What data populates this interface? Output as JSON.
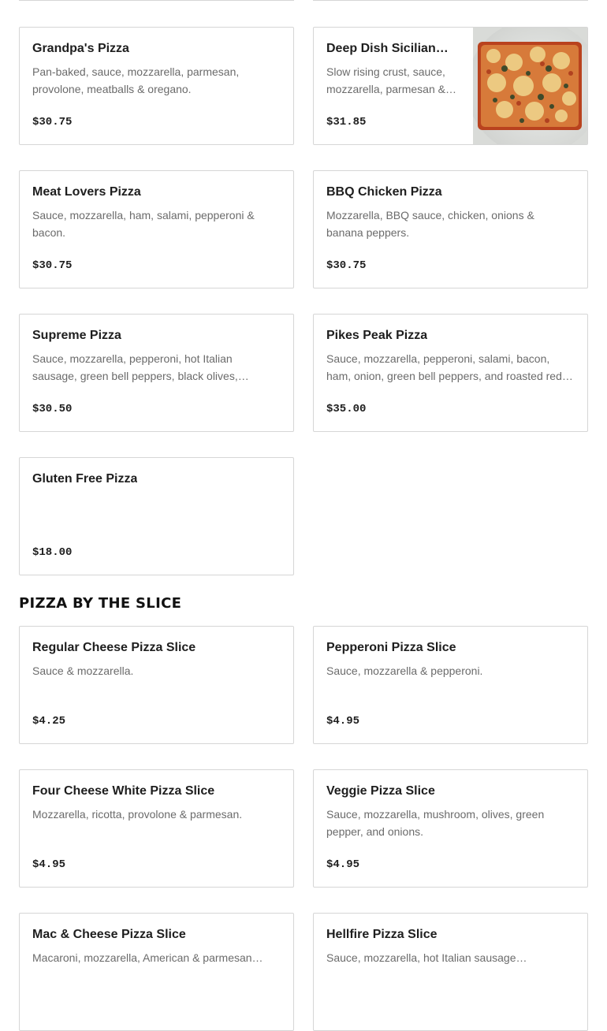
{
  "pizzas": [
    {
      "name": "Grandpa's Pizza",
      "desc": "Pan-baked, sauce, mozzarella, parmesan, provolone, meatballs & oregano.",
      "price": "$30.75"
    },
    {
      "name": "Deep Dish Sicilian…",
      "desc": "Slow rising crust, sauce, mozzarella, parmesan &…",
      "price": "$31.85",
      "image": "sicilian-pizza-photo"
    },
    {
      "name": "Meat Lovers Pizza",
      "desc": "Sauce, mozzarella, ham, salami, pepperoni & bacon.",
      "price": "$30.75"
    },
    {
      "name": "BBQ Chicken Pizza",
      "desc": "Mozzarella, BBQ sauce, chicken, onions & banana peppers.",
      "price": "$30.75"
    },
    {
      "name": "Supreme Pizza",
      "desc": "Sauce, mozzarella, pepperoni, hot Italian sausage, green bell peppers, black olives,…",
      "price": "$30.50"
    },
    {
      "name": "Pikes Peak Pizza",
      "desc": "Sauce, mozzarella, pepperoni, salami, bacon, ham, onion, green bell peppers, and roasted red…",
      "price": "$35.00"
    },
    {
      "name": "Gluten Free Pizza",
      "desc": "",
      "price": "$18.00"
    }
  ],
  "slice_section": {
    "title": "PIZZA BY THE SLICE"
  },
  "slices": [
    {
      "name": "Regular Cheese Pizza Slice",
      "desc": "Sauce & mozzarella.",
      "price": "$4.25"
    },
    {
      "name": "Pepperoni Pizza Slice",
      "desc": "Sauce, mozzarella & pepperoni.",
      "price": "$4.95"
    },
    {
      "name": "Four Cheese White Pizza Slice",
      "desc": "Mozzarella, ricotta, provolone & parmesan.",
      "price": "$4.95"
    },
    {
      "name": "Veggie Pizza Slice",
      "desc": "Sauce, mozzarella, mushroom, olives, green pepper, and onions.",
      "price": "$4.95"
    },
    {
      "name": "Mac & Cheese Pizza Slice",
      "desc": "Macaroni, mozzarella, American & parmesan…",
      "price": ""
    },
    {
      "name": "Hellfire Pizza Slice",
      "desc": "Sauce, mozzarella, hot Italian sausage…",
      "price": ""
    }
  ]
}
